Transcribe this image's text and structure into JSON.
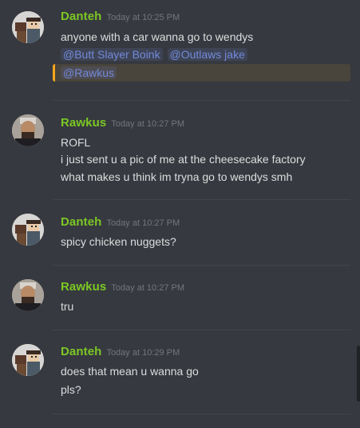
{
  "messages": [
    {
      "author": "Danteh",
      "timestamp": "Today at 10:25 PM",
      "lines": [
        "anyone with a car wanna go to wendys"
      ],
      "mentions_line": [
        "@Butt Slayer Boink",
        "@Outlaws jake"
      ],
      "highlighted_mention": "@Rawkus"
    },
    {
      "author": "Rawkus",
      "timestamp": "Today at 10:27 PM",
      "lines": [
        "ROFL",
        "i just sent u a pic of me at the cheesecake factory",
        "what makes u think im tryna go to wendys smh"
      ]
    },
    {
      "author": "Danteh",
      "timestamp": "Today at 10:27 PM",
      "lines": [
        "spicy chicken nuggets?"
      ]
    },
    {
      "author": "Rawkus",
      "timestamp": "Today at 10:27 PM",
      "lines": [
        "tru"
      ]
    },
    {
      "author": "Danteh",
      "timestamp": "Today at 10:29 PM",
      "lines": [
        "does that mean u wanna go",
        "pls?"
      ]
    }
  ],
  "colors": {
    "background": "#36393f",
    "username": "#7cc725",
    "mention": "#7289da",
    "mention_highlight_bar": "#faa61a"
  },
  "icons": {
    "avatar_danteh": "cartoon-character-avatar",
    "avatar_rawkus": "person-photo-avatar"
  }
}
